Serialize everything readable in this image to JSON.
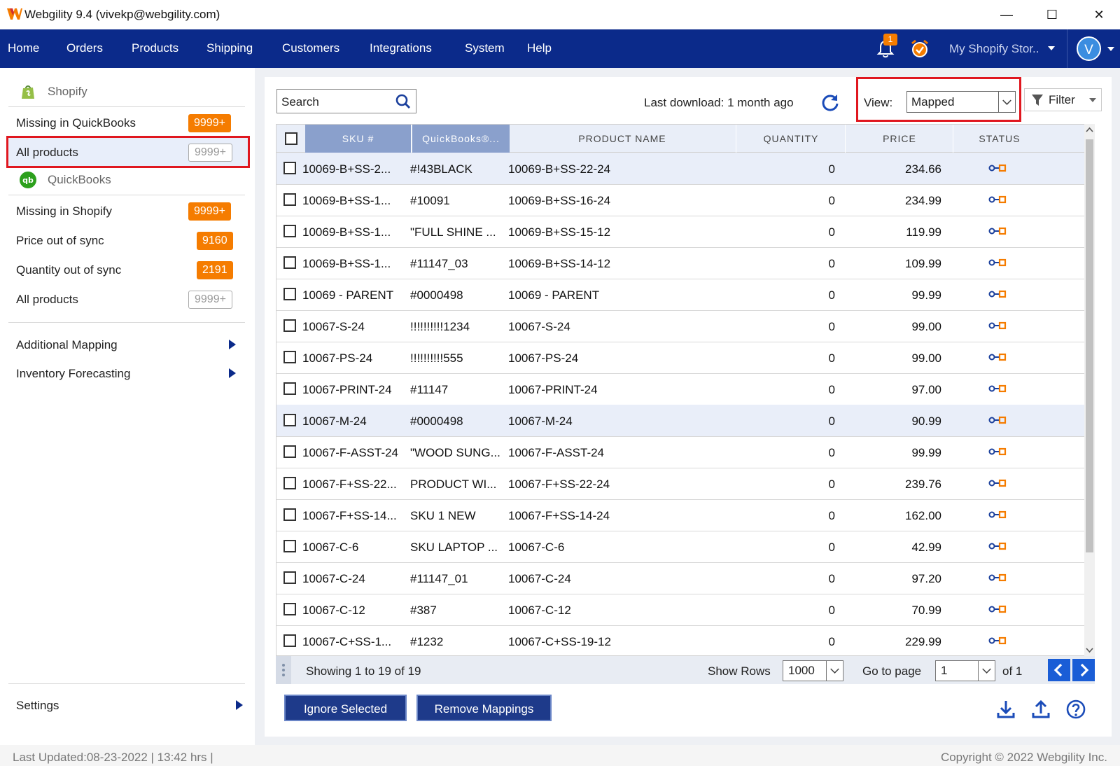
{
  "window": {
    "title": "Webgility 9.4 (vivekp@webgility.com)",
    "minimize": "—",
    "maximize": "☐",
    "close": "✕"
  },
  "nav": {
    "items": [
      "Home",
      "Orders",
      "Products",
      "Shipping",
      "Customers",
      "Integrations",
      "System",
      "Help"
    ],
    "notification_count": "1",
    "store": "My Shopify Stor..",
    "avatar": "V"
  },
  "sidebar": {
    "shopify_header": "Shopify",
    "shopify_items": [
      {
        "label": "Missing in QuickBooks",
        "badge": "9999+"
      },
      {
        "label": "All products",
        "badge": "9999+"
      }
    ],
    "quickbooks_header": "QuickBooks",
    "quickbooks_items": [
      {
        "label": "Missing in Shopify",
        "badge": "9999+"
      },
      {
        "label": "Price out of sync",
        "badge": "9160"
      },
      {
        "label": "Quantity out of sync",
        "badge": "2191"
      },
      {
        "label": "All products",
        "badge": "9999+"
      }
    ],
    "additional_mapping": "Additional Mapping",
    "inventory_forecasting": "Inventory Forecasting",
    "settings": "Settings"
  },
  "toolbar": {
    "search_placeholder": "Search",
    "last_download": "Last download: 1 month ago",
    "view_label": "View:",
    "view_value": "Mapped",
    "filter_label": "Filter"
  },
  "table": {
    "columns": [
      "SKU #",
      "QuickBooks®...",
      "PRODUCT NAME",
      "QUANTITY",
      "PRICE",
      "STATUS"
    ],
    "rows": [
      {
        "sku": "10069-B+SS-2...",
        "qb": "#!43BLACK",
        "name": "10069-B+SS-22-24",
        "qty": "0",
        "price": "234.66",
        "highlight": true
      },
      {
        "sku": "10069-B+SS-1...",
        "qb": "#10091",
        "name": "10069-B+SS-16-24",
        "qty": "0",
        "price": "234.99",
        "highlight": false
      },
      {
        "sku": "10069-B+SS-1...",
        "qb": "\"FULL SHINE ...",
        "name": "10069-B+SS-15-12",
        "qty": "0",
        "price": "119.99",
        "highlight": false
      },
      {
        "sku": "10069-B+SS-1...",
        "qb": "#11147_03",
        "name": "10069-B+SS-14-12",
        "qty": "0",
        "price": "109.99",
        "highlight": false
      },
      {
        "sku": "10069 - PARENT",
        "qb": "#0000498",
        "name": "10069 - PARENT",
        "qty": "0",
        "price": "99.99",
        "highlight": false
      },
      {
        "sku": "10067-S-24",
        "qb": "!!!!!!!!!!1234",
        "name": "10067-S-24",
        "qty": "0",
        "price": "99.00",
        "highlight": false
      },
      {
        "sku": "10067-PS-24",
        "qb": "!!!!!!!!!!555",
        "name": "10067-PS-24",
        "qty": "0",
        "price": "99.00",
        "highlight": false
      },
      {
        "sku": "10067-PRINT-24",
        "qb": "#11147",
        "name": "10067-PRINT-24",
        "qty": "0",
        "price": "97.00",
        "highlight": false
      },
      {
        "sku": "10067-M-24",
        "qb": "#0000498",
        "name": "10067-M-24",
        "qty": "0",
        "price": "90.99",
        "highlight": true
      },
      {
        "sku": "10067-F-ASST-24",
        "qb": "\"WOOD SUNG...",
        "name": "10067-F-ASST-24",
        "qty": "0",
        "price": "99.99",
        "highlight": false
      },
      {
        "sku": "10067-F+SS-22...",
        "qb": "PRODUCT WI...",
        "name": "10067-F+SS-22-24",
        "qty": "0",
        "price": "239.76",
        "highlight": false
      },
      {
        "sku": "10067-F+SS-14...",
        "qb": "SKU  1  NEW",
        "name": "10067-F+SS-14-24",
        "qty": "0",
        "price": "162.00",
        "highlight": false
      },
      {
        "sku": "10067-C-6",
        "qb": "SKU LAPTOP ...",
        "name": "10067-C-6",
        "qty": "0",
        "price": "42.99",
        "highlight": false
      },
      {
        "sku": "10067-C-24",
        "qb": "#11147_01",
        "name": "10067-C-24",
        "qty": "0",
        "price": "97.20",
        "highlight": false
      },
      {
        "sku": "10067-C-12",
        "qb": "#387",
        "name": "10067-C-12",
        "qty": "0",
        "price": "70.99",
        "highlight": false
      },
      {
        "sku": "10067-C+SS-1...",
        "qb": "#1232",
        "name": "10067-C+SS-19-12",
        "qty": "0",
        "price": "229.99",
        "highlight": false
      }
    ]
  },
  "pager": {
    "showing": "Showing 1 to 19 of 19",
    "show_rows_label": "Show Rows",
    "show_rows_value": "1000",
    "go_to_page_label": "Go to page",
    "page_value": "1",
    "of_pages": "of 1"
  },
  "actions": {
    "ignore_selected": "Ignore Selected",
    "remove_mappings": "Remove Mappings"
  },
  "status": {
    "last_updated": "Last Updated:08-23-2022 | 13:42 hrs |",
    "copyright": "Copyright © 2022 Webgility Inc."
  },
  "colors": {
    "nav_bg": "#0b2a8a",
    "accent_orange": "#f57c00",
    "highlight_red": "#e0171f",
    "button_blue": "#1e3a8a"
  }
}
